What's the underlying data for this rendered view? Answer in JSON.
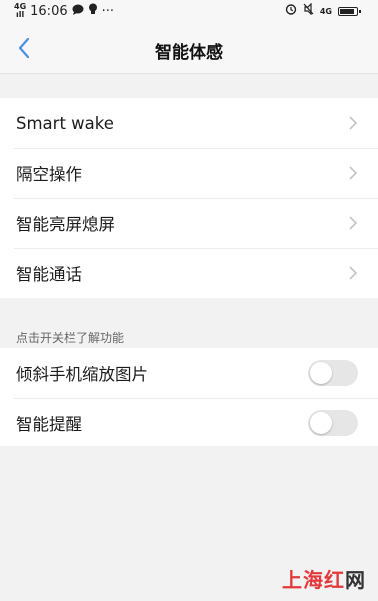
{
  "status_bar": {
    "network_top": "4G",
    "network_bottom": "ıll",
    "time": "16:06",
    "right_network": "4G",
    "more": "···"
  },
  "nav": {
    "title": "智能体感"
  },
  "group1": {
    "items": [
      {
        "label": "Smart wake"
      },
      {
        "label": "隔空操作"
      },
      {
        "label": "智能亮屏熄屏"
      },
      {
        "label": "智能通话"
      }
    ]
  },
  "section": {
    "header": "点击开关栏了解功能"
  },
  "group2": {
    "items": [
      {
        "label": "倾斜手机缩放图片",
        "enabled": false
      },
      {
        "label": "智能提醒",
        "enabled": false
      }
    ]
  },
  "watermark": {
    "part1": "上海红",
    "part2": "网"
  },
  "colors": {
    "accent": "#4a90e2",
    "toggle_off": "#e6e6e6",
    "background": "#f2f2f2",
    "watermark_red": "#e23a3a"
  },
  "icons": {
    "back": "chevron-left-icon",
    "row_arrow": "chevron-right-icon",
    "alarm": "alarm-icon",
    "mute": "mute-icon",
    "battery": "battery-icon",
    "chat": "chat-icon",
    "location": "location-icon"
  }
}
